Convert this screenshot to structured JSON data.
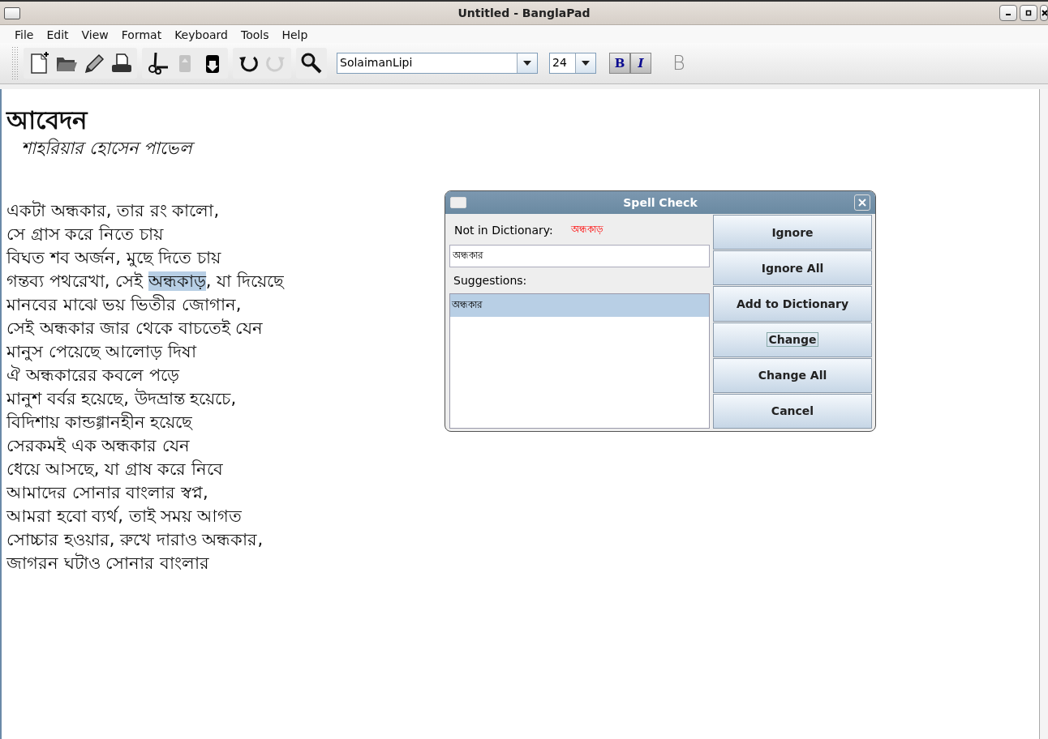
{
  "window": {
    "title": "Untitled - BanglaPad"
  },
  "menu": [
    "File",
    "Edit",
    "View",
    "Format",
    "Keyboard",
    "Tools",
    "Help"
  ],
  "toolbar": {
    "groups": [
      [
        {
          "kind": "new",
          "disabled": false
        },
        {
          "kind": "open",
          "disabled": false
        },
        {
          "kind": "pencil",
          "disabled": false
        },
        {
          "kind": "print",
          "disabled": false
        }
      ],
      [
        {
          "kind": "cut",
          "disabled": false
        },
        {
          "kind": "copy",
          "disabled": true
        },
        {
          "kind": "paste",
          "disabled": false
        }
      ],
      [
        {
          "kind": "undo",
          "disabled": false
        },
        {
          "kind": "redo",
          "disabled": true
        }
      ],
      [
        {
          "kind": "search",
          "disabled": false
        }
      ]
    ],
    "font": "SolaimanLipi",
    "size": "24",
    "bold_label": "B",
    "italic_label": "I",
    "layout_indicator": "B"
  },
  "document": {
    "heading": "আবেদন",
    "author": "শাহরিয়ার হোসেন পাভেল",
    "lines": [
      {
        "segments": [
          {
            "text": "একটা অন্ধকার, তার রং কালো,",
            "selected": false
          }
        ]
      },
      {
        "segments": [
          {
            "text": "সে গ্রাস করে নিতে চায়",
            "selected": false
          }
        ]
      },
      {
        "segments": [
          {
            "text": "বিঘত শব অর্জন, মুছে দিতে চায়",
            "selected": false
          }
        ]
      },
      {
        "segments": [
          {
            "text": "গন্তব্য পথরেখা, সেই ",
            "selected": false
          },
          {
            "text": "অন্ধকাড়",
            "selected": true
          },
          {
            "text": ", যা দিয়েছে",
            "selected": false
          }
        ]
      },
      {
        "segments": [
          {
            "text": "মানবের মাঝে ভয় ভিতীর জোগান,",
            "selected": false
          }
        ]
      },
      {
        "segments": [
          {
            "text": "সেই অন্ধকার জার থেকে বাচতেই যেন",
            "selected": false
          }
        ]
      },
      {
        "segments": [
          {
            "text": "মানুস পেয়েছে আলোড় দিষা",
            "selected": false
          }
        ]
      },
      {
        "segments": [
          {
            "text": "ঐ অন্ধকারের কবলে পড়ে",
            "selected": false
          }
        ]
      },
      {
        "segments": [
          {
            "text": "মানুশ বর্বর হয়েছে, উদভ্রান্ত হয়েচে,",
            "selected": false
          }
        ]
      },
      {
        "segments": [
          {
            "text": "বিদিশায় কান্ডগ্গানহীন হয়েছে",
            "selected": false
          }
        ]
      },
      {
        "segments": [
          {
            "text": "সেরকমই এক অন্ধকার যেন",
            "selected": false
          }
        ]
      },
      {
        "segments": [
          {
            "text": "ধেয়ে আসছে, যা গ্রাষ করে নিবে",
            "selected": false
          }
        ]
      },
      {
        "segments": [
          {
            "text": "আমাদের সোনার বাংলার স্বপ্ন,",
            "selected": false
          }
        ]
      },
      {
        "segments": [
          {
            "text": "আমরা হবো ব্যর্থ, তাই সময় আগত",
            "selected": false
          }
        ]
      },
      {
        "segments": [
          {
            "text": "সোচ্চার হওয়ার, রুখে দারাও অন্ধকার,",
            "selected": false
          }
        ]
      },
      {
        "segments": [
          {
            "text": "জাগরন ঘটাও সোনার বাংলার",
            "selected": false
          }
        ]
      }
    ]
  },
  "dialog": {
    "title": "Spell Check",
    "not_in_dictionary_label": "Not in Dictionary:",
    "misspelled": "অন্ধকাড়",
    "replacement": "অন্ধকার",
    "suggestions_label": "Suggestions:",
    "suggestions": [
      {
        "text": "অন্ধকার",
        "selected": true
      }
    ],
    "buttons": [
      {
        "label": "Ignore",
        "focused": false
      },
      {
        "label": "Ignore All",
        "focused": false
      },
      {
        "label": "Add to Dictionary",
        "focused": false
      },
      {
        "label": "Change",
        "focused": true
      },
      {
        "label": "Change All",
        "focused": false
      },
      {
        "label": "Cancel",
        "focused": false
      }
    ]
  }
}
